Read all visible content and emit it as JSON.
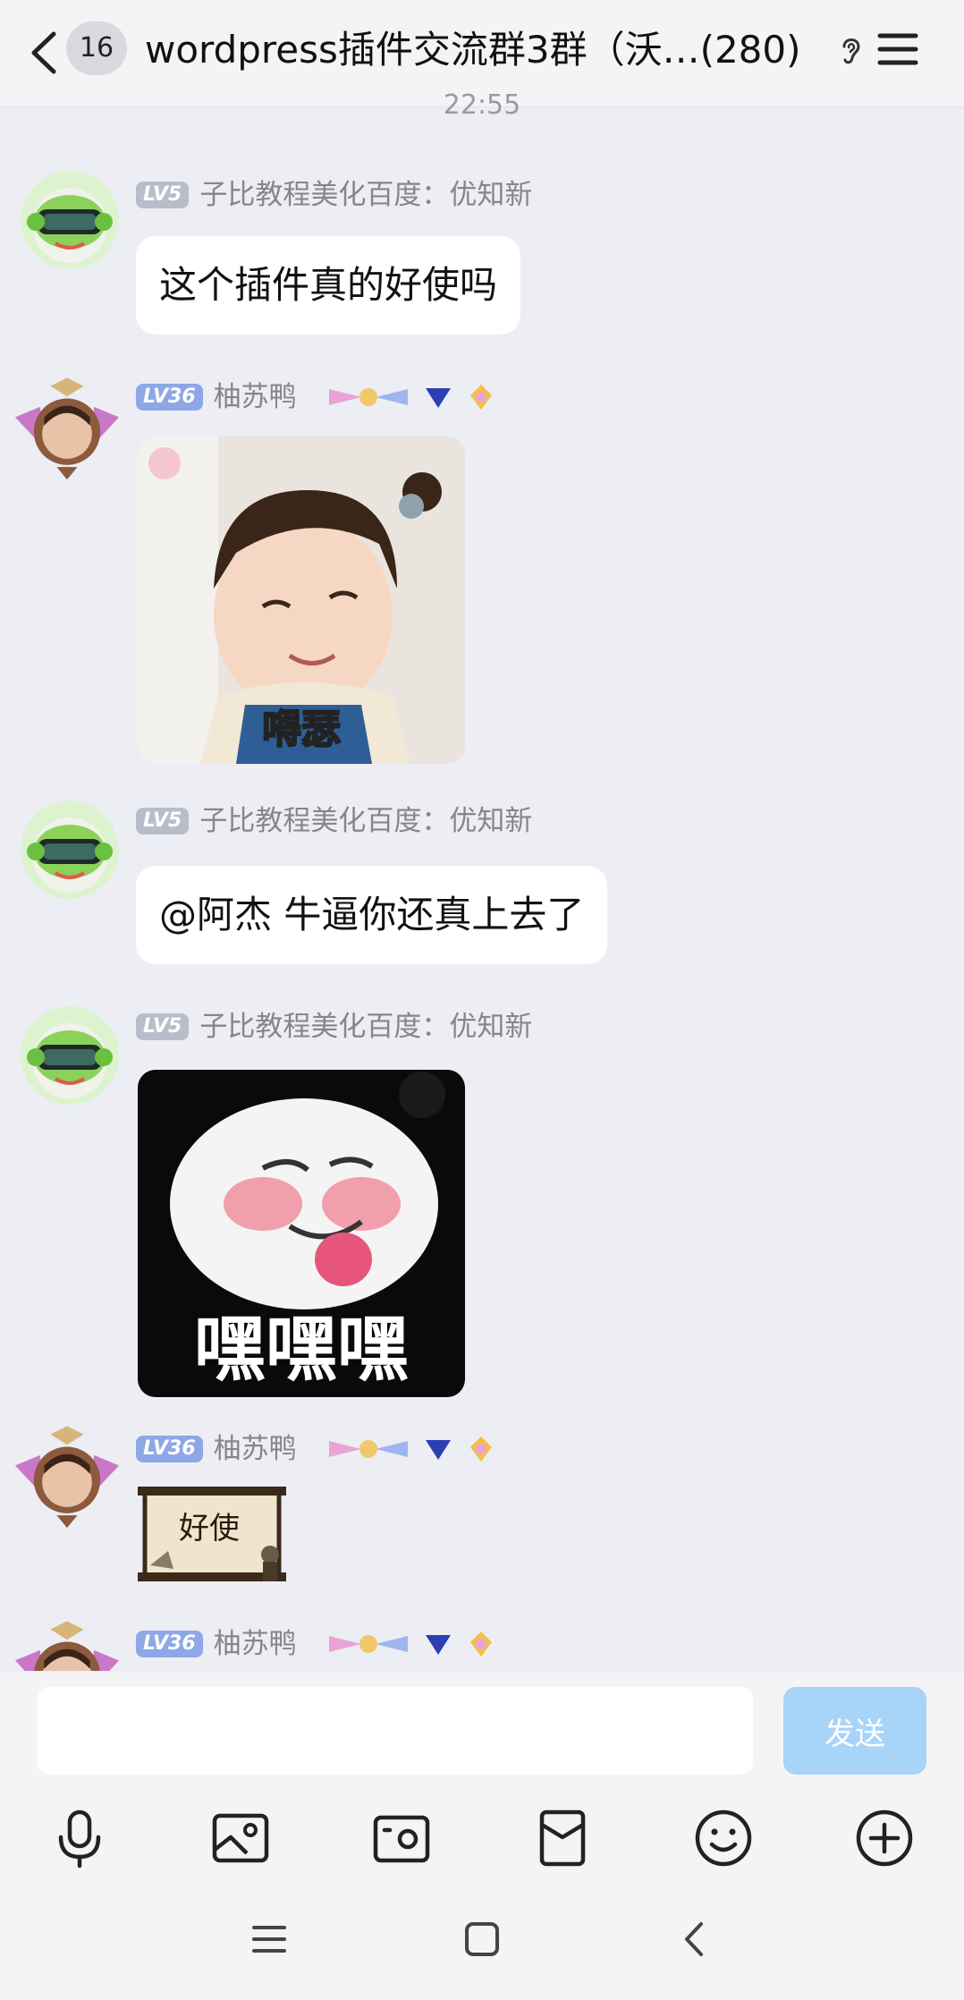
{
  "header": {
    "unread_count": "16",
    "title": "wordpress插件交流群3群（沃…(280)"
  },
  "timestamp": "22:55",
  "messages": [
    {
      "level": "LV5",
      "sender": "子比教程美化百度：优知新",
      "text": "这个插件真的好使吗"
    },
    {
      "level": "LV36",
      "sender": "柚苏鸭",
      "sticker_caption": "嘚瑟"
    },
    {
      "level": "LV5",
      "sender": "子比教程美化百度：优知新",
      "text": "@阿杰 牛逼你还真上去了"
    },
    {
      "level": "LV5",
      "sender": "子比教程美化百度：优知新",
      "sticker_caption": "嘿嘿嘿"
    },
    {
      "level": "LV36",
      "sender": "柚苏鸭",
      "sticker_caption": "好使"
    },
    {
      "level": "LV36",
      "sender": "柚苏鸭"
    }
  ],
  "input": {
    "placeholder": "",
    "send_label": "发送"
  },
  "toolbar": [
    "mic-icon",
    "image-icon",
    "camera-icon",
    "red-packet-icon",
    "emoji-icon",
    "plus-icon"
  ],
  "colors": {
    "background": "#EDEDF4",
    "send_button": "#A8D4F8",
    "level_badge": "#B9BDCB",
    "level_badge_high": "#8EA7E6"
  }
}
